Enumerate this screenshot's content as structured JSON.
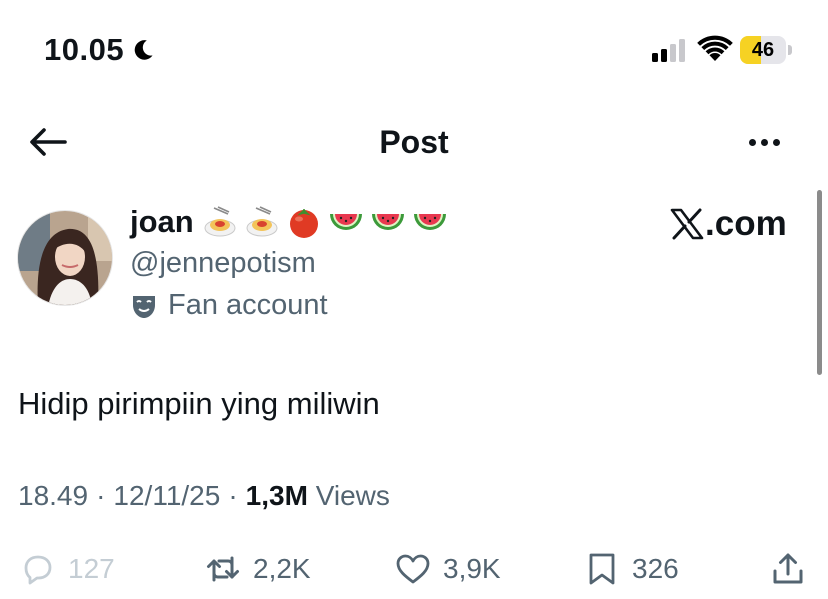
{
  "status_bar": {
    "time": "10.05",
    "battery": "46",
    "battery_level": 0.46,
    "signal_bars_active": 2,
    "signal_bars_total": 4
  },
  "header": {
    "title": "Post"
  },
  "author": {
    "display_name": "joan",
    "emojis": [
      "spaghetti",
      "spaghetti",
      "tomato",
      "watermelon",
      "watermelon",
      "watermelon"
    ],
    "handle": "@jennepotism",
    "label": "Fan account",
    "label_icon": "theater-mask-icon"
  },
  "watermark": {
    "text": ".com"
  },
  "tweet": {
    "text": "Hidip pirimpiin ying miliwin",
    "time": "18.49",
    "date": "12/11/25",
    "views_count": "1,3M",
    "views_label": "Views"
  },
  "actions": {
    "replies": "127",
    "reposts": "2,2K",
    "likes": "3,9K",
    "bookmarks": "326"
  },
  "colors": {
    "text_primary": "#0f1419",
    "text_secondary": "#536471",
    "battery_fill": "#f6d223"
  }
}
